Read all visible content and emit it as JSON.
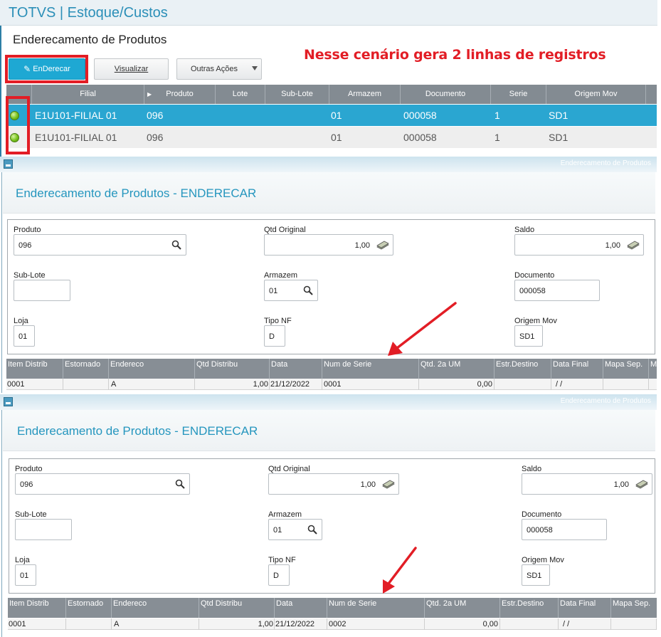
{
  "app": {
    "title": "TOTVS | Estoque/Custos"
  },
  "page": {
    "title": "Enderecamento de Produtos"
  },
  "annotation": "Nesse cenário gera 2 linhas de registros",
  "toolbar": {
    "enderecar_label": "EnDerecar",
    "visualizar_label": "Visualizar",
    "outras_label": "Outras Ações"
  },
  "grid": {
    "columns": [
      "Filial",
      "Produto",
      "Lote",
      "Sub-Lote",
      "Armazem",
      "Documento",
      "Serie",
      "Origem Mov"
    ],
    "rows": [
      {
        "status": "green",
        "filial": "E1U101-FILIAL 01",
        "produto": "096",
        "armazem": "01",
        "documento": "000058",
        "serie": "1",
        "origem": "SD1"
      },
      {
        "status": "green",
        "filial": "E1U101-FILIAL 01",
        "produto": "096",
        "armazem": "01",
        "documento": "000058",
        "serie": "1",
        "origem": "SD1"
      }
    ]
  },
  "modals": [
    {
      "bar_title": "Enderecamento de Produtos",
      "title": "Enderecamento de Produtos - ENDERECAR",
      "fields": {
        "produto_label": "Produto",
        "produto_value": "096",
        "qtd_original_label": "Qtd Original",
        "qtd_original_value": "1,00",
        "saldo_label": "Saldo",
        "saldo_value": "1,00",
        "sublote_label": "Sub-Lote",
        "sublote_value": "",
        "armazem_label": "Armazem",
        "armazem_value": "01",
        "documento_label": "Documento",
        "documento_value": "000058",
        "loja_label": "Loja",
        "loja_value": "01",
        "tipo_nf_label": "Tipo NF",
        "tipo_nf_value": "D",
        "origem_label": "Origem Mov",
        "origem_value": "SD1"
      },
      "columns": [
        "Item Distrib",
        "Estornado",
        "Endereco",
        "Qtd Distribu",
        "Data",
        "Num de Serie",
        "Qtd. 2a UM",
        "Estr.Destino",
        "Data Final",
        "Mapa Sep.",
        "M"
      ],
      "row": {
        "item": "0001",
        "estornado": "",
        "endereco": "A",
        "qtd": "1,00",
        "data": "21/12/2022",
        "serie": "0001",
        "qtd2": "0,00",
        "destino": "",
        "data_final": "/ /",
        "mapa": ""
      }
    },
    {
      "bar_title": "Enderecamento de Produtos",
      "title": "Enderecamento de Produtos - ENDERECAR",
      "fields": {
        "produto_label": "Produto",
        "produto_value": "096",
        "qtd_original_label": "Qtd Original",
        "qtd_original_value": "1,00",
        "saldo_label": "Saldo",
        "saldo_value": "1,00",
        "sublote_label": "Sub-Lote",
        "sublote_value": "",
        "armazem_label": "Armazem",
        "armazem_value": "01",
        "documento_label": "Documento",
        "documento_value": "000058",
        "loja_label": "Loja",
        "loja_value": "01",
        "tipo_nf_label": "Tipo NF",
        "tipo_nf_value": "D",
        "origem_label": "Origem Mov",
        "origem_value": "SD1"
      },
      "columns": [
        "Item Distrib",
        "Estornado",
        "Endereco",
        "Qtd Distribu",
        "Data",
        "Num de Serie",
        "Qtd. 2a UM",
        "Estr.Destino",
        "Data Final",
        "Mapa Sep."
      ],
      "row": {
        "item": "0001",
        "estornado": "",
        "endereco": "A",
        "qtd": "1,00",
        "data": "21/12/2022",
        "serie": "0002",
        "qtd2": "0,00",
        "destino": "",
        "data_final": "/ /",
        "mapa": ""
      }
    }
  ],
  "colors": {
    "accent": "#2596be",
    "selected_row": "#2aa6d1",
    "grid_header": "#838b92",
    "annotation": "#e21d25",
    "status_ok": "#77c21c"
  },
  "icons": [
    "pencil-icon",
    "search-icon",
    "money-icon",
    "window-icon",
    "status-green-icon",
    "sort-arrow-icon"
  ]
}
